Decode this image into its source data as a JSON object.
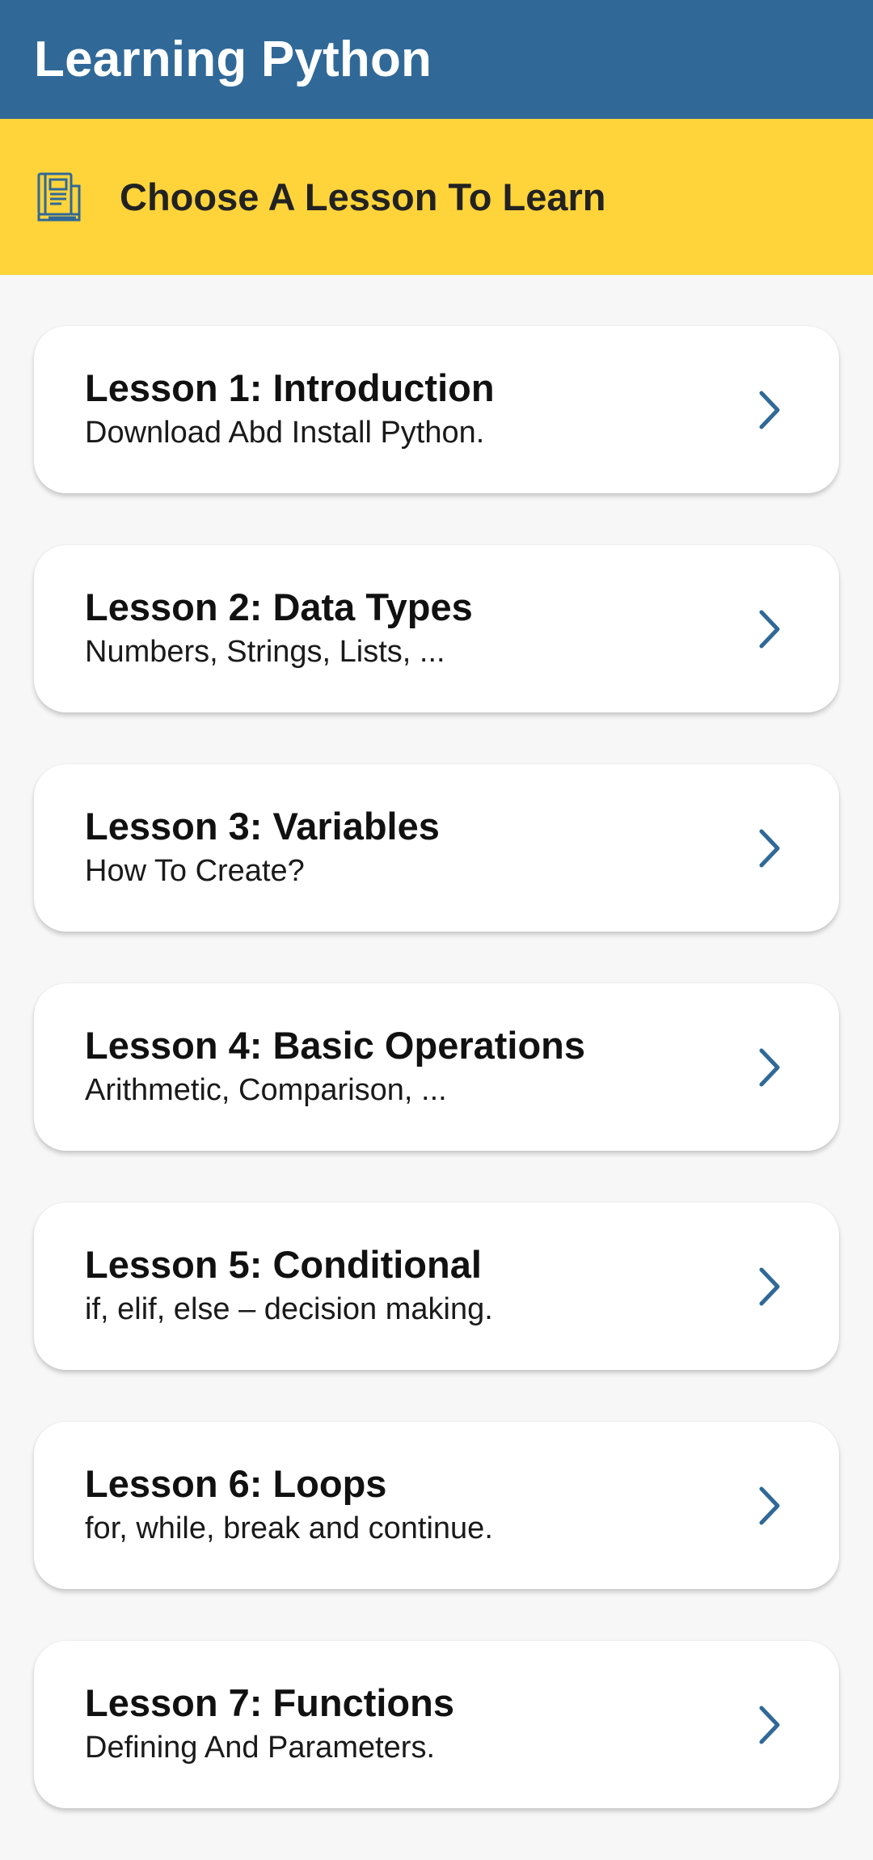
{
  "app_bar": {
    "title": "Learning Python",
    "background": "#306998"
  },
  "banner": {
    "icon": "book-icon",
    "text": "Choose A Lesson To Learn",
    "background": "#ffd43b"
  },
  "lessons": [
    {
      "title": "Lesson 1: Introduction",
      "subtitle": "Download Abd Install Python."
    },
    {
      "title": "Lesson 2: Data Types",
      "subtitle": "Numbers, Strings, Lists, ..."
    },
    {
      "title": "Lesson 3: Variables",
      "subtitle": "How To Create?"
    },
    {
      "title": "Lesson 4: Basic Operations",
      "subtitle": "Arithmetic, Comparison, ..."
    },
    {
      "title": "Lesson 5: Conditional",
      "subtitle": "if, elif, else – decision making."
    },
    {
      "title": "Lesson 6: Loops",
      "subtitle": "for, while, break and continue."
    },
    {
      "title": "Lesson 7: Functions",
      "subtitle": "Defining And Parameters."
    }
  ],
  "colors": {
    "chevron": "#306998"
  }
}
